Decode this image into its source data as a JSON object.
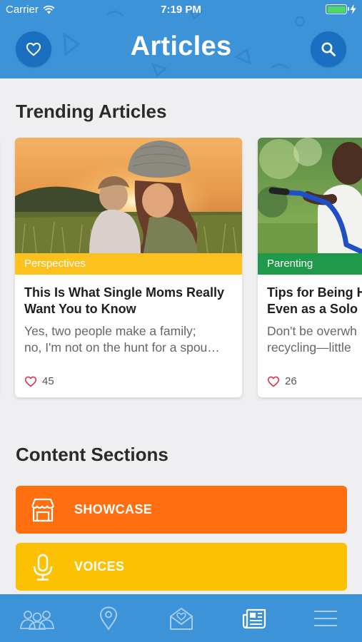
{
  "status_bar": {
    "carrier": "Carrier",
    "time": "7:19 PM"
  },
  "header": {
    "title": "Articles",
    "left_icon": "heart-icon",
    "right_icon": "search-icon"
  },
  "trending": {
    "title": "Trending Articles",
    "cards": [
      {
        "category": "Perspectives",
        "category_color": "#fcc11c",
        "title_line1": "This Is What Single Moms Really",
        "title_line2": "Want You to Know",
        "excerpt_line1": "Yes, two people make a family;",
        "excerpt_line2": "no, I'm not on the hunt for a spou…",
        "likes": "45"
      },
      {
        "category": "Parenting",
        "category_color": "#1f9a4a",
        "title_line1": "Tips for Being H",
        "title_line2": "Even as a Solo",
        "excerpt_line1": "Don't be overwh",
        "excerpt_line2": "recycling—little",
        "likes": "26"
      }
    ]
  },
  "content_sections": {
    "title": "Content Sections",
    "items": [
      {
        "label": "SHOWCASE",
        "icon": "storefront-icon",
        "color": "#ff6f10"
      },
      {
        "label": "VOICES",
        "icon": "microphone-icon",
        "color": "#fdc104"
      }
    ]
  },
  "tab_bar": {
    "items": [
      {
        "icon": "community-icon"
      },
      {
        "icon": "location-pin-icon"
      },
      {
        "icon": "mail-heart-icon"
      },
      {
        "icon": "newspaper-icon",
        "active": true
      },
      {
        "icon": "menu-icon"
      }
    ]
  },
  "colors": {
    "primary": "#3d93d8",
    "primary_dark": "#1a6fc0",
    "background": "#efeff1"
  }
}
